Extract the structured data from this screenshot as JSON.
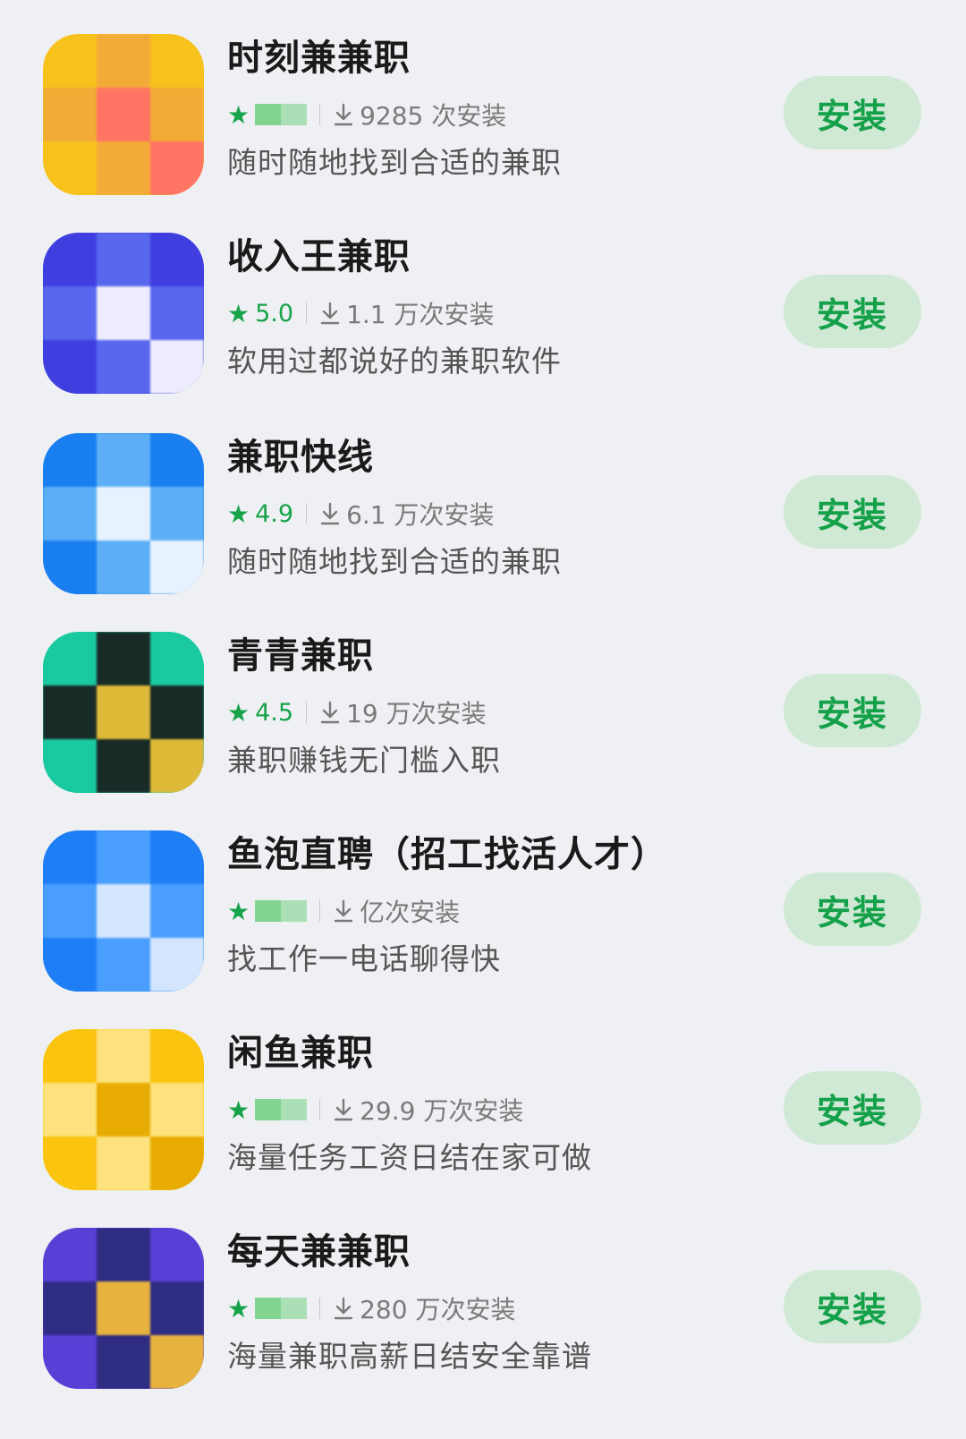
{
  "apps": [
    {
      "name": "时刻兼兼职",
      "rating": "",
      "downloads": "9285 次安装",
      "description": "随时随地找到合适的兼职",
      "button": "安装",
      "icon": "yellow-person-icon",
      "icon_colors": [
        "#f7c21d",
        "#f2a93b",
        "#ff6b6b"
      ]
    },
    {
      "name": "收入王兼职",
      "rating": "5.0",
      "downloads": "1.1 万次安装",
      "description": "软用过都说好的兼职软件",
      "button": "安装",
      "icon": "money-bag-icon",
      "icon_colors": [
        "#3f3fe0",
        "#5b6cf0",
        "#ffffff"
      ]
    },
    {
      "name": "兼职快线",
      "rating": "4.9",
      "downloads": "6.1 万次安装",
      "description": "随时随地找到合适的兼职",
      "button": "安装",
      "icon": "blue-job-icon",
      "icon_colors": [
        "#1a7ff0",
        "#64b5f6",
        "#ffffff"
      ]
    },
    {
      "name": "青青兼职",
      "rating": "4.5",
      "downloads": "19 万次安装",
      "description": "兼职赚钱无门槛入职",
      "button": "安装",
      "icon": "green-black-icon",
      "icon_colors": [
        "#19c9a0",
        "#1a1a1a",
        "#f5b82e"
      ]
    },
    {
      "name": "鱼泡直聘（招工找活人才）",
      "rating": "",
      "downloads": "亿次安装",
      "description": "找工作一电话聊得快",
      "button": "安装",
      "icon": "fish-bubble-icon",
      "icon_colors": [
        "#1e7ef5",
        "#4fa3ff",
        "#e8f2ff"
      ]
    },
    {
      "name": "闲鱼兼职",
      "rating": "",
      "downloads": "29.9 万次安装",
      "description": "海量任务工资日结在家可做",
      "button": "安装",
      "icon": "yellow-box-icon",
      "icon_colors": [
        "#f9c410",
        "#fde68a",
        "#e5a800"
      ]
    },
    {
      "name": "每天兼兼职",
      "rating": "",
      "downloads": "280 万次安装",
      "description": "海量兼职高薪日结安全靠谱",
      "button": "安装",
      "icon": "purple-robot-icon",
      "icon_colors": [
        "#5a3fd6",
        "#2a2a7a",
        "#f5c02e"
      ]
    }
  ],
  "accent": "#15a04a",
  "button_bg": "#cfe9d4",
  "background": "#eff0f3"
}
